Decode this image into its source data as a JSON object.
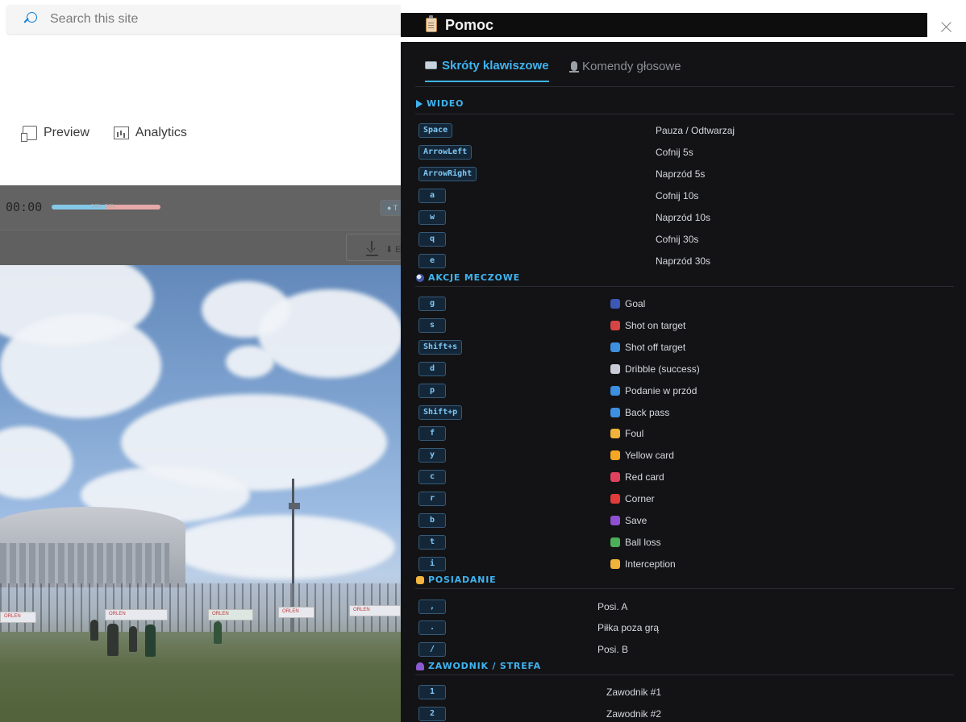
{
  "background": {
    "search_placeholder": "Search this site",
    "commands": [
      {
        "label": "Preview",
        "icon": "preview-icon"
      },
      {
        "label": "Analytics",
        "icon": "analytics-icon"
      }
    ],
    "player": {
      "timecode": "00:00",
      "progress_text": "50% 50%",
      "progress_split": 0.5,
      "chip_label": "● T",
      "download_label": "⬇ E"
    }
  },
  "panel": {
    "title": "Pomoc",
    "title_icon": "clipboard-icon",
    "tabs": [
      {
        "label": "Skróty klawiszowe",
        "icon": "keyboard-icon",
        "active": true
      },
      {
        "label": "Komendy głosowe",
        "icon": "microphone-icon",
        "active": false
      }
    ],
    "sections": {
      "video": {
        "title": "WIDEO",
        "icon": "play-triangle-icon",
        "rows": [
          {
            "key": "Space",
            "desc": "Pauza / Odtwarzaj"
          },
          {
            "key": "ArrowLeft",
            "desc": "Cofnij 5s"
          },
          {
            "key": "ArrowRight",
            "desc": "Naprzód 5s"
          },
          {
            "key": "a",
            "desc": "Cofnij 10s"
          },
          {
            "key": "w",
            "desc": "Naprzód 10s"
          },
          {
            "key": "q",
            "desc": "Cofnij 30s"
          },
          {
            "key": "e",
            "desc": "Naprzód 30s"
          }
        ]
      },
      "actions": {
        "title": "AKCJE MECZOWE",
        "icon": "soccer-ball-icon",
        "rows": [
          {
            "key": "g",
            "desc": "Goal",
            "icon": "soccer-ball-icon",
            "color": "#3d57b5"
          },
          {
            "key": "s",
            "desc": "Shot on target",
            "icon": "target-icon",
            "color": "#d64545"
          },
          {
            "key": "Shift+s",
            "desc": "Shot off target",
            "icon": "arrow-up-right-icon",
            "color": "#3d8fe0"
          },
          {
            "key": "d",
            "desc": "Dribble (success)",
            "icon": "dash-icon",
            "color": "#c9ccd6"
          },
          {
            "key": "p",
            "desc": "Podanie w przód",
            "icon": "arrow-up-icon",
            "color": "#3d8fe0"
          },
          {
            "key": "Shift+p",
            "desc": "Back pass",
            "icon": "return-arrow-icon",
            "color": "#3d8fe0"
          },
          {
            "key": "f",
            "desc": "Foul",
            "icon": "fist-icon",
            "color": "#f0b23a"
          },
          {
            "key": "y",
            "desc": "Yellow card",
            "icon": "yellow-card-icon",
            "color": "#f5a623"
          },
          {
            "key": "c",
            "desc": "Red card",
            "icon": "red-card-icon",
            "color": "#e0425e"
          },
          {
            "key": "r",
            "desc": "Corner",
            "icon": "corner-flag-icon",
            "color": "#e23b3b"
          },
          {
            "key": "b",
            "desc": "Save",
            "icon": "glove-icon",
            "color": "#8e4fd0"
          },
          {
            "key": "t",
            "desc": "Ball loss",
            "icon": "money-wings-icon",
            "color": "#4cae5b"
          },
          {
            "key": "i",
            "desc": "Interception",
            "icon": "raised-hand-icon",
            "color": "#f0b23a"
          }
        ]
      },
      "possession": {
        "title": "POSIADANIE",
        "icon": "handshake-icon",
        "rows": [
          {
            "key": ",",
            "desc": "Posi. A"
          },
          {
            "key": ".",
            "desc": "Piłka poza grą"
          },
          {
            "key": "/",
            "desc": "Posi. B"
          }
        ]
      },
      "player": {
        "title": "ZAWODNIK / STREFA",
        "icon": "person-icon",
        "rows": [
          {
            "key": "1",
            "desc": "Zawodnik #1"
          },
          {
            "key": "2",
            "desc": "Zawodnik #2"
          }
        ]
      }
    }
  }
}
